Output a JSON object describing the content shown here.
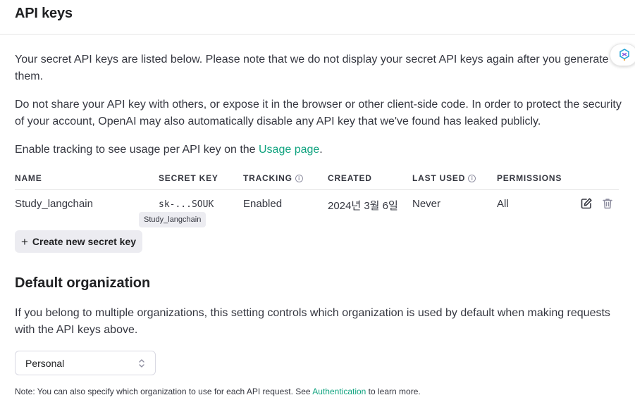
{
  "header": {
    "title": "API keys"
  },
  "intro": {
    "p1": "Your secret API keys are listed below. Please note that we do not display your secret API keys again after you generate them.",
    "p2": "Do not share your API key with others, or expose it in the browser or other client-side code. In order to protect the security of your account, OpenAI may also automatically disable any API key that we've found has leaked publicly.",
    "p3_prefix": "Enable tracking to see usage per API key on the ",
    "p3_link": "Usage page",
    "p3_suffix": "."
  },
  "table": {
    "columns": {
      "name": "NAME",
      "secret_key": "SECRET KEY",
      "tracking": "TRACKING",
      "created": "CREATED",
      "last_used": "LAST USED",
      "permissions": "PERMISSIONS"
    },
    "rows": [
      {
        "name": "Study_langchain",
        "secret_key": "sk-...SOUK",
        "tracking": "Enabled",
        "created": "2024년 3월 6일",
        "last_used": "Never",
        "permissions": "All"
      }
    ],
    "tooltip": "Study_langchain"
  },
  "create_button": {
    "icon": "+",
    "label": "Create new secret key"
  },
  "default_org": {
    "title": "Default organization",
    "description": "If you belong to multiple organizations, this setting controls which organization is used by default when making requests with the API keys above.",
    "selected": "Personal"
  },
  "note": {
    "prefix": "Note: You can also specify which organization to use for each API request. See ",
    "link": "Authentication",
    "suffix": " to learn more."
  },
  "icons": {
    "info": "info-icon",
    "edit": "edit-icon",
    "delete": "trash-icon",
    "select": "chevron-updown-icon",
    "floating": "assistant-logo-icon"
  },
  "colors": {
    "link": "#10a37f",
    "button_bg": "#ececf1",
    "text": "#353740"
  }
}
